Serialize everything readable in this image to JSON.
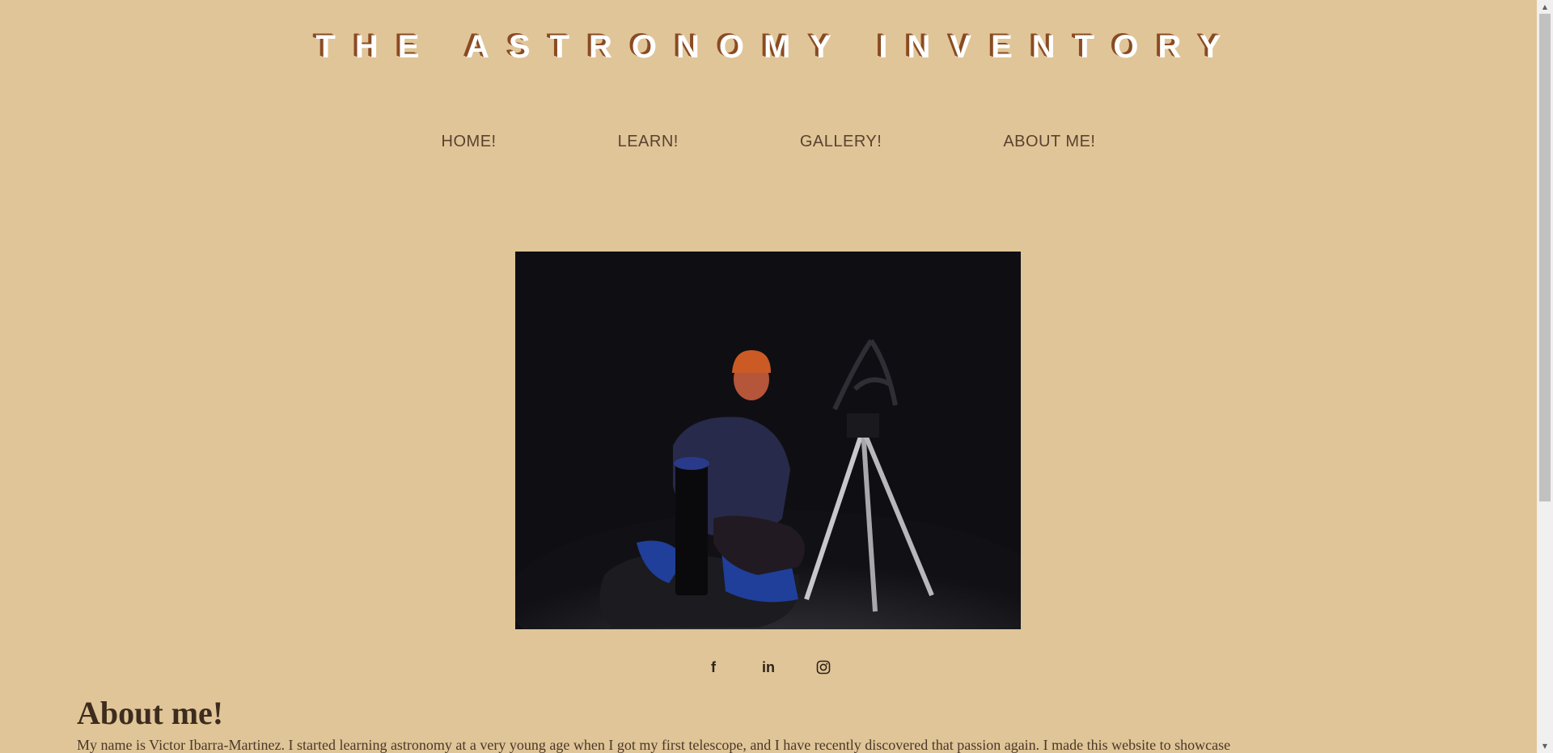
{
  "site": {
    "title": "THE ASTRONOMY INVENTORY"
  },
  "nav": {
    "items": [
      {
        "label": "HOME!"
      },
      {
        "label": "LEARN!"
      },
      {
        "label": "GALLERY!"
      },
      {
        "label": "ABOUT ME!"
      }
    ]
  },
  "social": {
    "facebook": "f",
    "linkedin": "in",
    "instagram_icon": "instagram-icon"
  },
  "about": {
    "heading": "About me!",
    "text": "My name is Victor Ibarra-Martinez. I started learning astronomy at a very young age when I got my first telescope, and I have recently discovered that passion again. I made this website to showcase"
  },
  "colors": {
    "background": "#e0c598",
    "title_shadow": "#8a4b22",
    "nav_text": "#5a4230"
  }
}
